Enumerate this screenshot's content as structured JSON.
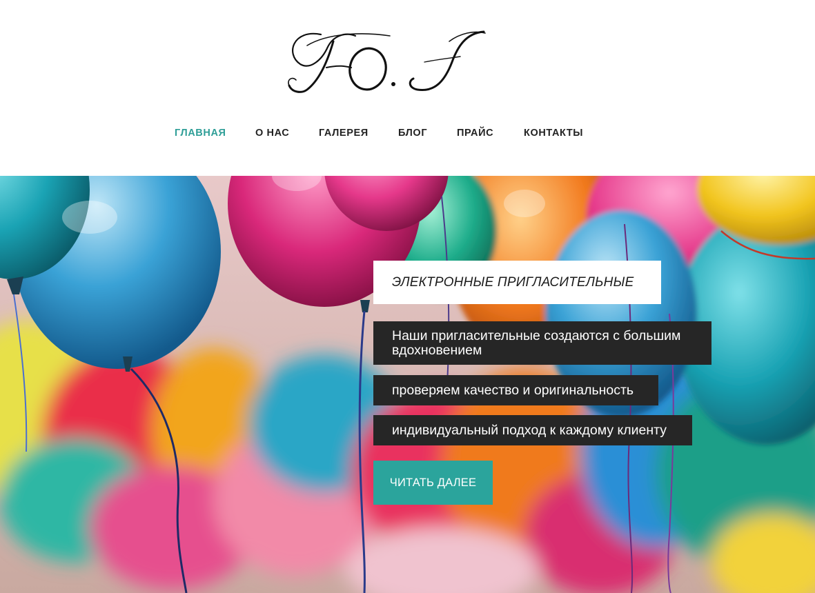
{
  "brand": {
    "logo_text": "ЮJ"
  },
  "nav": {
    "items": [
      {
        "label": "ГЛАВНАЯ",
        "active": true
      },
      {
        "label": "О НАС",
        "active": false
      },
      {
        "label": "ГАЛЕРЕЯ",
        "active": false
      },
      {
        "label": "БЛОГ",
        "active": false
      },
      {
        "label": "ПРАЙС",
        "active": false
      },
      {
        "label": "КОНТАКТЫ",
        "active": false
      }
    ]
  },
  "hero": {
    "background": "colorful-balloons-image",
    "tagline": "ЭЛЕКТРОННЫЕ ПРИГЛАСИТЕЛЬНЫЕ",
    "features": [
      "Наши пригласительные создаются с большим вдохновением",
      "проверяем качество и оригинальность",
      "индивидуальный подход к каждому клиенту"
    ],
    "cta_label": "ЧИТАТЬ ДАЛЕЕ"
  },
  "colors": {
    "accent": "#2ba49c",
    "nav_active": "#2e9e97",
    "feature_bg": "#262626",
    "text_dark": "#222222"
  }
}
